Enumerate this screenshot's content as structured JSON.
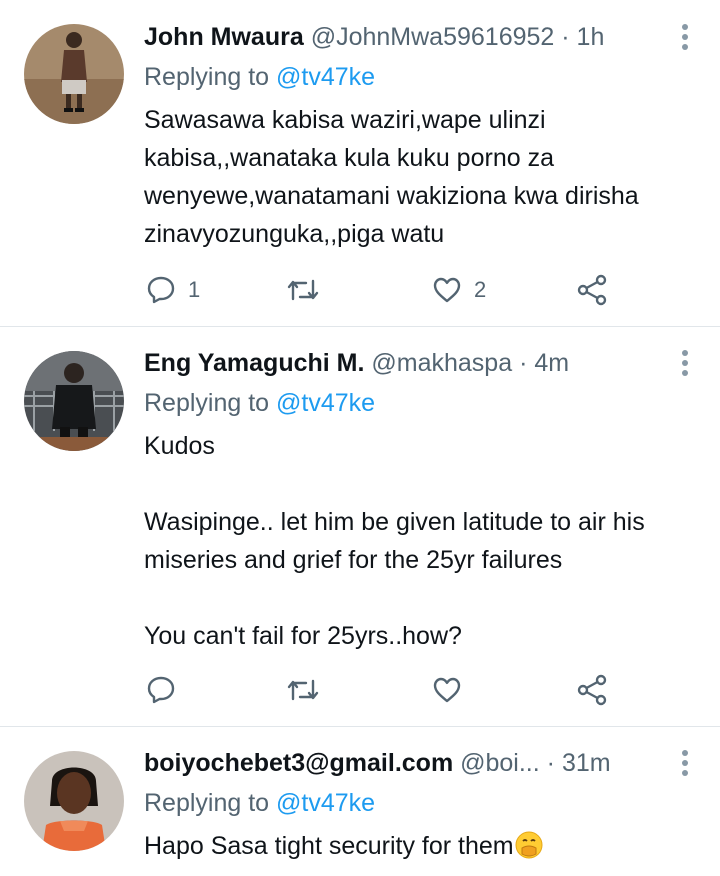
{
  "tweets": [
    {
      "display_name": "John Mwaura",
      "handle": "@JohnMwa59616952",
      "separator": "·",
      "time": "1h",
      "replying_prefix": "Replying to",
      "replying_to": "@tv47ke",
      "text": "Sawasawa kabisa waziri,wape ulinzi kabisa,,wanataka kula kuku porno za wenyewe,wanatamani wakiziona kwa dirisha zinavyozunguka,,piga watu",
      "reply_count": "1",
      "retweet_count": "",
      "like_count": "2"
    },
    {
      "display_name": "Eng Yamaguchi M.",
      "handle": "@makhaspa",
      "separator": "·",
      "time": "4m",
      "replying_prefix": "Replying to",
      "replying_to": "@tv47ke",
      "text": "Kudos\n\nWasipinge.. let him be given latitude to air his miseries and grief for the 25yr failures\n\nYou can't fail for 25yrs..how?",
      "reply_count": "",
      "retweet_count": "",
      "like_count": ""
    },
    {
      "display_name": "boiyochebet3@gmail.com",
      "handle": "@boi...",
      "separator": "·",
      "time": "31m",
      "replying_prefix": "Replying to",
      "replying_to": "@tv47ke",
      "text": "Hapo Sasa tight security for them",
      "emoji": "face-with-hand-over-mouth-emoji"
    }
  ],
  "colors": {
    "text_primary": "#0f1419",
    "text_secondary": "#536471",
    "mention": "#1d9bf0",
    "divider": "#e1e6ea"
  },
  "icons": [
    "reply-icon",
    "retweet-icon",
    "like-icon",
    "share-icon",
    "more-options-icon"
  ]
}
